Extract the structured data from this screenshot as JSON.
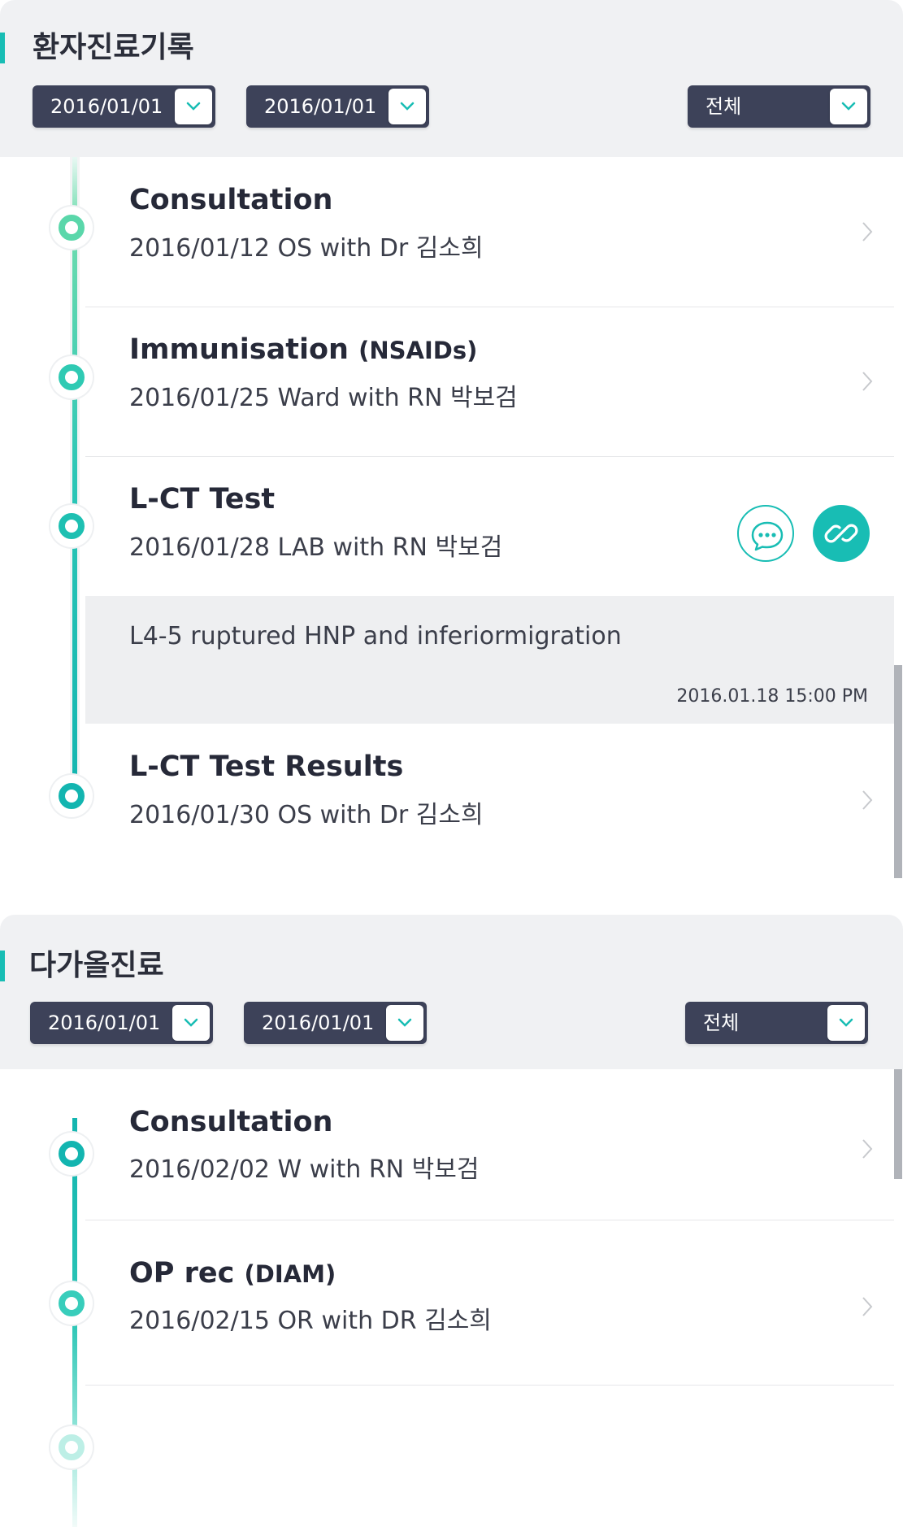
{
  "colors": {
    "accent": "#18bdb4",
    "select_bg": "#3d4259",
    "panel_bg": "#f0f1f3",
    "memo_bg": "#eeeff1"
  },
  "section1": {
    "title": "환자진료기록",
    "filters": {
      "from": "2016/01/01",
      "to": "2016/01/01",
      "type": "전체"
    },
    "records": [
      {
        "title": "Consultation",
        "sub": "",
        "info": "2016/01/12 OS with Dr 김소희"
      },
      {
        "title": "Immunisation",
        "sub": "(NSAIDs)",
        "info": "2016/01/25 Ward with RN 박보검"
      },
      {
        "title": "L-CT Test",
        "sub": "",
        "info": "2016/01/28 LAB with RN 박보검",
        "memo": {
          "text": "L4-5 ruptured HNP and inferiormigration",
          "time": "2016.01.18  15:00 PM"
        }
      },
      {
        "title": "L-CT Test Results",
        "sub": "",
        "info": "2016/01/30 OS with Dr 김소희"
      }
    ],
    "icons": {
      "comment": "chat-bubble-icon",
      "link": "link-icon",
      "chevron": "chevron-right-icon"
    }
  },
  "section2": {
    "title": "다가올진료",
    "filters": {
      "from": "2016/01/01",
      "to": "2016/01/01",
      "type": "전체"
    },
    "records": [
      {
        "title": "Consultation",
        "sub": "",
        "info": "2016/02/02 W with RN 박보검"
      },
      {
        "title": "OP rec",
        "sub": "(DIAM)",
        "info": "2016/02/15 OR with DR 김소희"
      }
    ]
  }
}
